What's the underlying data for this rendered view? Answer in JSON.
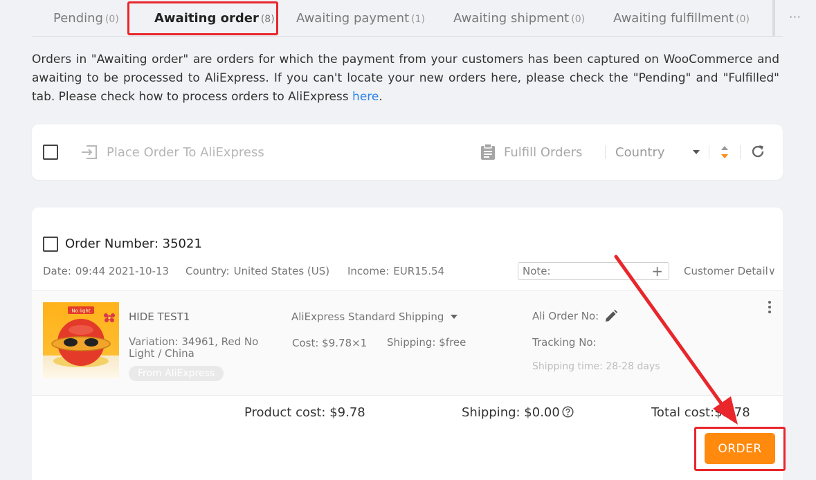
{
  "tabs": [
    {
      "label": "Pending",
      "count": "(0)"
    },
    {
      "label": "Awaiting order",
      "count": "(8)"
    },
    {
      "label": "Awaiting payment",
      "count": "(1)"
    },
    {
      "label": "Awaiting shipment",
      "count": "(0)"
    },
    {
      "label": "Awaiting fulfillment",
      "count": "(0)"
    }
  ],
  "tab_more": "···",
  "description": {
    "text": "Orders in \"Awaiting order\" are orders for which the payment from your customers has been captured on WooCommerce and awaiting to be processed to AliExpress. If you can't locate your new orders here, please check the \"Pending\" and \"Fulfilled\" tab. Please check how to process orders to AliExpress ",
    "link": "here",
    "tail": "."
  },
  "toolbar": {
    "place_order": "Place Order To AliExpress",
    "fulfill_orders": "Fulfill Orders",
    "country": "Country"
  },
  "order": {
    "title": "Order Number: 35021",
    "date_label": "Date:",
    "date": "09:44 2021-10-13",
    "country_label": "Country:",
    "country": "United States (US)",
    "income_label": "Income:",
    "income": "EUR15.54",
    "note_placeholder": "Note:",
    "note_add": "+",
    "customer_detail": "Customer Detail∨",
    "product": {
      "name": "HIDE TEST1",
      "variation": "Variation: 34961, Red No Light / China",
      "badge": "From AliExpress",
      "thumb_label": "No light",
      "shipping_method": "AliExpress Standard Shipping",
      "cost": "Cost: $9.78×1",
      "shipping": "Shipping: $free",
      "ali_order_no": "Ali Order No:",
      "tracking_no": "Tracking No:",
      "shipping_time": "Shipping time: 28-28 days"
    },
    "product_cost": "Product cost: $9.78",
    "shipping_total": "Shipping: $0.00",
    "total_cost": "Total cost:$9.78",
    "order_button": "ORDER"
  },
  "colors": {
    "accent": "#ff8a0e",
    "link": "#2f83e5",
    "highlight": "#e8262b"
  }
}
